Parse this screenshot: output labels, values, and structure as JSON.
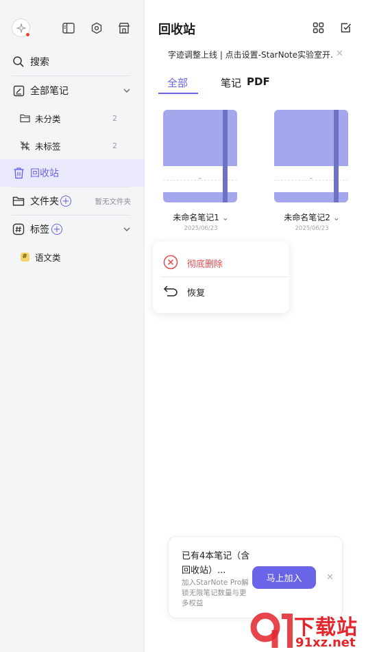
{
  "sidebar": {
    "search_label": "搜索",
    "all_notes_label": "全部笔记",
    "uncategorized": {
      "label": "未分类",
      "count": "2"
    },
    "untagged": {
      "label": "未标签",
      "count": "2"
    },
    "recycle_label": "回收站",
    "folders_label": "文件夹",
    "folders_empty_note": "暂无文件夹",
    "tags_label": "标签",
    "tag_items": [
      {
        "label": "语文类",
        "icon": "hash-badge-icon"
      }
    ]
  },
  "main": {
    "title": "回收站",
    "notice": "字迹调整上线 | 点击设置-StarNote实验室开...",
    "tabs": [
      "全部",
      "笔记",
      "PDF"
    ],
    "notes": [
      {
        "title": "未命名笔记1",
        "date": "2025/06/23"
      },
      {
        "title": "未命名笔记2",
        "date": "2025/06/23"
      }
    ],
    "context_menu": {
      "delete_label": "彻底删除",
      "restore_label": "恢复"
    },
    "promo": {
      "title": "已有4本笔记（含回收站）...",
      "description": "加入StarNote Pro解锁无限笔记数量与更多权益",
      "button_label": "马上加入"
    }
  },
  "watermark": {
    "big_text": "下载站",
    "small_text": "91xz.net"
  },
  "colors": {
    "accent": "#6a64e8",
    "danger": "#e5484d",
    "cover": "#a5a7ec",
    "strap": "#6e72c2"
  }
}
